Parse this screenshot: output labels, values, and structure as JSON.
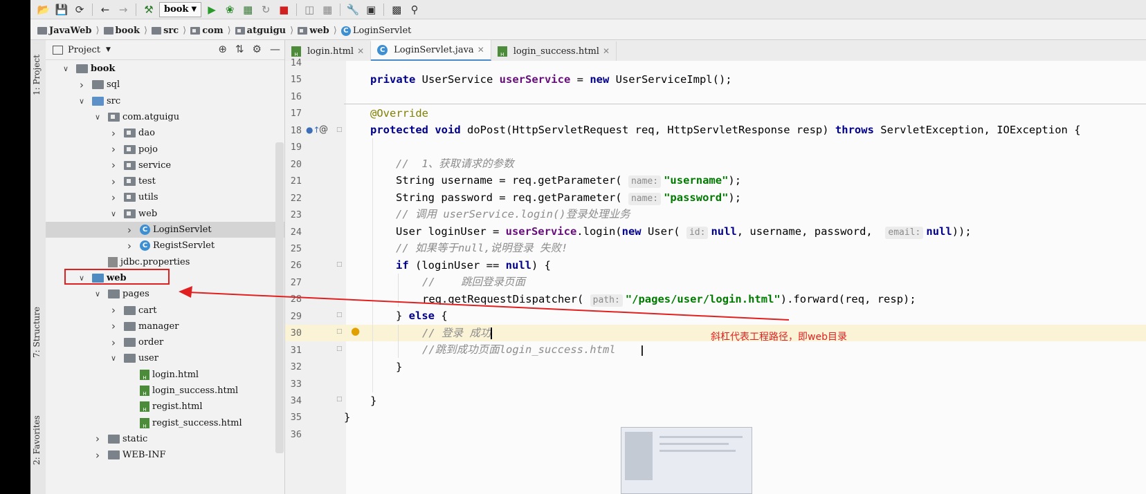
{
  "toolbar": {
    "run_config": "book",
    "icons": [
      "open-folder-icon",
      "save-icon",
      "sync-icon",
      "back-arrow-icon",
      "forward-arrow-icon",
      "hammer-icon",
      "run-icon",
      "debug-icon",
      "coverage-icon",
      "profile-icon",
      "stop-icon",
      "sdk-icon",
      "structure-icon",
      "wrench-icon",
      "project-structure-icon",
      "terminal-icon",
      "search-icon"
    ]
  },
  "breadcrumb": [
    "JavaWeb",
    "book",
    "src",
    "com",
    "atguigu",
    "web",
    "LoginServlet"
  ],
  "left_tool_windows": [
    "1: Project",
    "7: Structure",
    "2: Favorites"
  ],
  "project_panel": {
    "title": "Project",
    "tree": [
      {
        "label": "book",
        "depth": 0,
        "expanded": true,
        "kind": "module"
      },
      {
        "label": "sql",
        "depth": 1,
        "expanded": false,
        "kind": "folder"
      },
      {
        "label": "src",
        "depth": 1,
        "expanded": true,
        "kind": "source"
      },
      {
        "label": "com.atguigu",
        "depth": 2,
        "expanded": true,
        "kind": "package"
      },
      {
        "label": "dao",
        "depth": 3,
        "expanded": false,
        "kind": "package"
      },
      {
        "label": "pojo",
        "depth": 3,
        "expanded": false,
        "kind": "package"
      },
      {
        "label": "service",
        "depth": 3,
        "expanded": false,
        "kind": "package"
      },
      {
        "label": "test",
        "depth": 3,
        "expanded": false,
        "kind": "package"
      },
      {
        "label": "utils",
        "depth": 3,
        "expanded": false,
        "kind": "package"
      },
      {
        "label": "web",
        "depth": 3,
        "expanded": true,
        "kind": "package"
      },
      {
        "label": "LoginServlet",
        "depth": 4,
        "expanded": false,
        "kind": "class",
        "selected": true
      },
      {
        "label": "RegistServlet",
        "depth": 4,
        "expanded": false,
        "kind": "class"
      },
      {
        "label": "jdbc.properties",
        "depth": 2,
        "kind": "props"
      },
      {
        "label": "web",
        "depth": 1,
        "expanded": true,
        "kind": "webroot"
      },
      {
        "label": "pages",
        "depth": 2,
        "expanded": true,
        "kind": "folder"
      },
      {
        "label": "cart",
        "depth": 3,
        "expanded": false,
        "kind": "folder"
      },
      {
        "label": "manager",
        "depth": 3,
        "expanded": false,
        "kind": "folder"
      },
      {
        "label": "order",
        "depth": 3,
        "expanded": false,
        "kind": "folder"
      },
      {
        "label": "user",
        "depth": 3,
        "expanded": true,
        "kind": "folder"
      },
      {
        "label": "login.html",
        "depth": 4,
        "kind": "html"
      },
      {
        "label": "login_success.html",
        "depth": 4,
        "kind": "html"
      },
      {
        "label": "regist.html",
        "depth": 4,
        "kind": "html"
      },
      {
        "label": "regist_success.html",
        "depth": 4,
        "kind": "html"
      },
      {
        "label": "static",
        "depth": 2,
        "expanded": false,
        "kind": "folder"
      },
      {
        "label": "WEB-INF",
        "depth": 2,
        "expanded": false,
        "kind": "folder"
      }
    ]
  },
  "editor": {
    "tabs": [
      {
        "label": "login.html",
        "kind": "html",
        "active": false
      },
      {
        "label": "LoginServlet.java",
        "kind": "class",
        "active": true
      },
      {
        "label": "login_success.html",
        "kind": "html",
        "active": false
      }
    ],
    "line_numbers": [
      "14",
      "15",
      "16",
      "17",
      "18",
      "19",
      "20",
      "21",
      "22",
      "23",
      "24",
      "25",
      "26",
      "27",
      "28",
      "29",
      "30",
      "31",
      "32",
      "33",
      "34",
      "35",
      "36"
    ],
    "code": {
      "l15_kw": "private",
      "l15_type": " UserService ",
      "l15_field": "userService",
      "l15_eq": " = ",
      "l15_new": "new",
      "l15_rest": " UserServiceImpl();",
      "l17_ann": "@Override",
      "l18_kw1": "protected",
      "l18_kw2": "void",
      "l18_mid": " doPost(HttpServletRequest req, HttpServletResponse resp) ",
      "l18_throws": "throws",
      "l18_rest": " ServletException, IOException {",
      "l20": "//  1、获取请求的参数",
      "l21_a": "String username = req.getParameter( ",
      "l21_hint": "name:",
      "l21_str": "\"username\"",
      "l21_b": ");",
      "l22_a": "String password = req.getParameter( ",
      "l22_hint": "name:",
      "l22_str": "\"password\"",
      "l22_b": ");",
      "l23": "// 调用 userService.login()登录处理业务",
      "l24_a": "User loginUser = ",
      "l24_field": "userService",
      "l24_b": ".login(",
      "l24_new": "new",
      "l24_c": " User( ",
      "l24_hint1": "id:",
      "l24_null1": "null",
      "l24_d": ", username, password,  ",
      "l24_hint2": "email:",
      "l24_null2": "null",
      "l24_e": "));",
      "l25": "// 如果等于null,说明登录 失败!",
      "l26_if": "if",
      "l26_a": " (loginUser == ",
      "l26_null": "null",
      "l26_b": ") {",
      "l27": "//    跳回登录页面",
      "l28_a": "req.getRequestDispatcher( ",
      "l28_hint": "path:",
      "l28_str": "\"/pages/user/login.html\"",
      "l28_b": ").forward(req, resp);",
      "l29_a": "} ",
      "l29_else": "else",
      "l29_b": " {",
      "l30": "// 登录 成功",
      "l31": "//跳到成功页面login_success.html",
      "l32": "}",
      "l34": "}",
      "l35": "}"
    }
  },
  "annotation": {
    "note": "斜杠代表工程路径，即web目录",
    "color": "#e02020"
  }
}
